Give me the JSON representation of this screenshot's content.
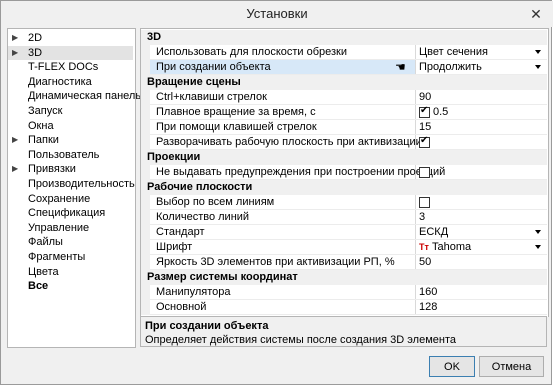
{
  "window": {
    "title": "Установки",
    "close_glyph": "✕"
  },
  "tree": {
    "items": [
      {
        "label": "2D",
        "arrow": true
      },
      {
        "label": "3D",
        "arrow": true,
        "selected": true
      },
      {
        "label": "T-FLEX DOCs"
      },
      {
        "label": "Диагностика"
      },
      {
        "label": "Динамическая панель"
      },
      {
        "label": "Запуск"
      },
      {
        "label": "Окна"
      },
      {
        "label": "Папки",
        "arrow": true
      },
      {
        "label": "Пользователь"
      },
      {
        "label": "Привязки",
        "arrow": true
      },
      {
        "label": "Производительность"
      },
      {
        "label": "Сохранение"
      },
      {
        "label": "Спецификация"
      },
      {
        "label": "Управление"
      },
      {
        "label": "Файлы"
      },
      {
        "label": "Фрагменты"
      },
      {
        "label": "Цвета"
      },
      {
        "label": "Все",
        "bold": true
      }
    ]
  },
  "grid": {
    "rows": [
      {
        "type": "cat",
        "name": "3D"
      },
      {
        "type": "prop",
        "name": "Использовать для плоскости обрезки",
        "value": "Цвет сечения",
        "dropdown": true
      },
      {
        "type": "prop",
        "name": "При создании объекта",
        "value": "Продолжить",
        "dropdown": true,
        "selected": true
      },
      {
        "type": "cat",
        "name": "Вращение сцены"
      },
      {
        "type": "prop",
        "name": "Ctrl+клавиши стрелок",
        "value": "90"
      },
      {
        "type": "prop",
        "name": "Плавное вращение за время, с",
        "value": "0.5",
        "checkbox": true,
        "checked": true
      },
      {
        "type": "prop",
        "name": "При помощи клавишей стрелок",
        "value": "15"
      },
      {
        "type": "prop",
        "name": "Разворачивать рабочую плоскость при активизации",
        "checkbox": true,
        "checked": true
      },
      {
        "type": "cat",
        "name": "Проекции"
      },
      {
        "type": "prop",
        "name": "Не выдавать предупреждения при построении проекций",
        "checkbox": true,
        "checked": false
      },
      {
        "type": "cat",
        "name": "Рабочие плоскости"
      },
      {
        "type": "prop",
        "name": "Выбор по всем линиям",
        "checkbox": true,
        "checked": false
      },
      {
        "type": "prop",
        "name": "Количество линий",
        "value": "3"
      },
      {
        "type": "prop",
        "name": "Стандарт",
        "value": "ЕСКД",
        "dropdown": true
      },
      {
        "type": "prop",
        "name": "Шрифт",
        "value": "Tahoma",
        "dropdown": true,
        "fonticon": true
      },
      {
        "type": "prop",
        "name": "Яркость 3D элементов при активизации РП, %",
        "value": "50"
      },
      {
        "type": "cat",
        "name": "Размер системы координат"
      },
      {
        "type": "prop",
        "name": "Манипулятора",
        "value": "160"
      },
      {
        "type": "prop",
        "name": "Основной",
        "value": "128"
      }
    ]
  },
  "description": {
    "title": "При создании объекта",
    "text": "Определяет действия системы после создания 3D элемента"
  },
  "buttons": {
    "ok": "OK",
    "cancel": "Отмена"
  },
  "icons": {
    "font_icon": "Tт",
    "checkmark": "✔",
    "tree_arrow": "▶",
    "cursor": "☚"
  }
}
